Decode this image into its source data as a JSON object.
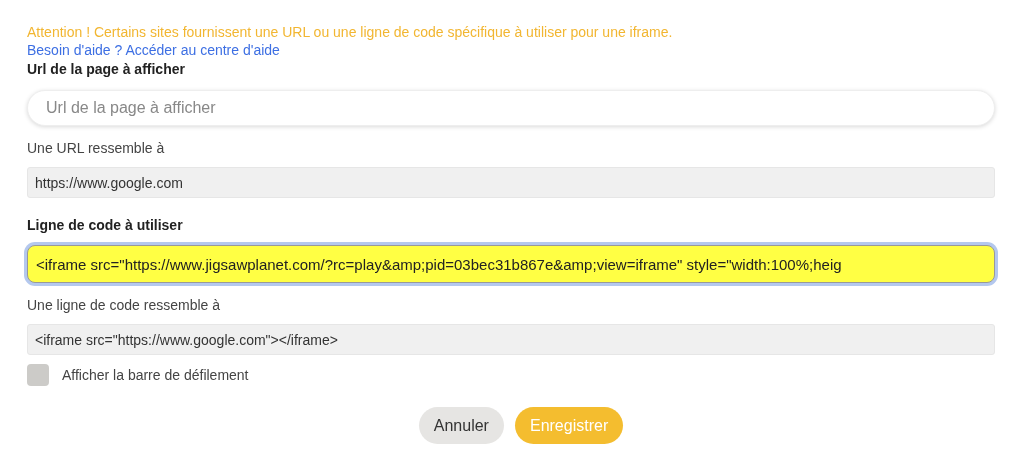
{
  "notice": "Attention ! Certains sites fournissent une URL ou une ligne de code spécifique à utiliser pour une iframe.",
  "help_link": "Besoin d'aide ? Accéder au centre d'aide",
  "url_field": {
    "label": "Url de la page à afficher",
    "placeholder": "Url de la page à afficher"
  },
  "url_example": {
    "label": "Une URL ressemble à",
    "value": "https://www.google.com"
  },
  "code_field": {
    "label": "Ligne de code à utiliser",
    "value": "<iframe src=\"https://www.jigsawplanet.com/?rc=play&amp;pid=03bec31b867e&amp;view=iframe\" style=\"width:100%;heig",
    "focused": true
  },
  "code_example": {
    "label": "Une ligne de code ressemble à",
    "value": "<iframe src=\"https://www.google.com\"></iframe>"
  },
  "scrollbar_option": {
    "label": "Afficher la barre de défilement",
    "checked": false
  },
  "buttons": [
    {
      "kind": "secondary",
      "label": "Annuler"
    },
    {
      "kind": "primary",
      "label": "Enregistrer"
    }
  ]
}
